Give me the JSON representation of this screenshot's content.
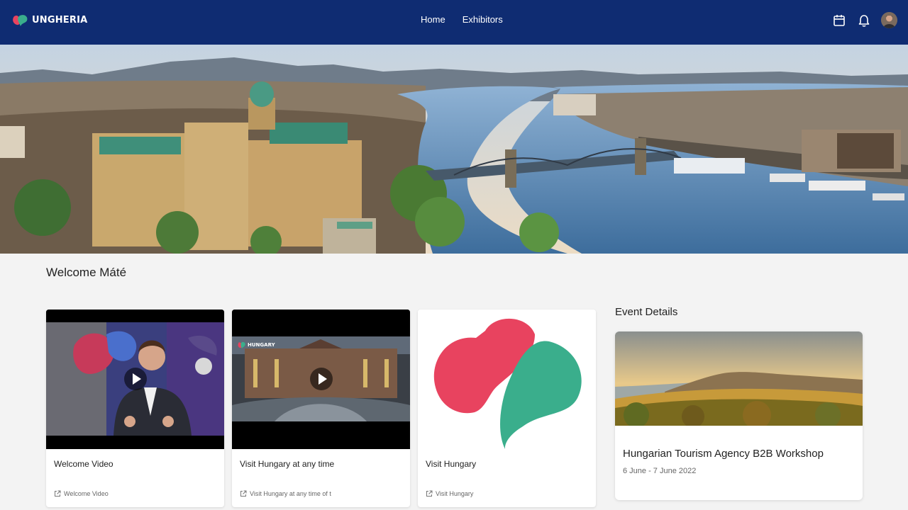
{
  "brand": {
    "name": "UNGHERIA"
  },
  "nav": {
    "home": "Home",
    "exhibitors": "Exhibitors"
  },
  "header_icons": [
    "calendar-icon",
    "bell-icon",
    "user-avatar"
  ],
  "welcome": "Welcome Máté",
  "cards": [
    {
      "title": "Welcome Video",
      "link": "Welcome Video",
      "type": "video"
    },
    {
      "title": "Visit Hungary at any time",
      "link": "Visit Hungary at any time of t",
      "type": "video",
      "overlay": "HUNGARY"
    },
    {
      "title": "Visit Hungary",
      "link": "Visit Hungary",
      "type": "image"
    }
  ],
  "event": {
    "heading": "Event Details",
    "title": "Hungarian Tourism Agency B2B Workshop",
    "date": "6 June - 7 June 2022"
  },
  "colors": {
    "header": "#0f2c72",
    "brand_red": "#e8435f",
    "brand_green": "#3aae8c",
    "background": "#f3f3f3"
  }
}
